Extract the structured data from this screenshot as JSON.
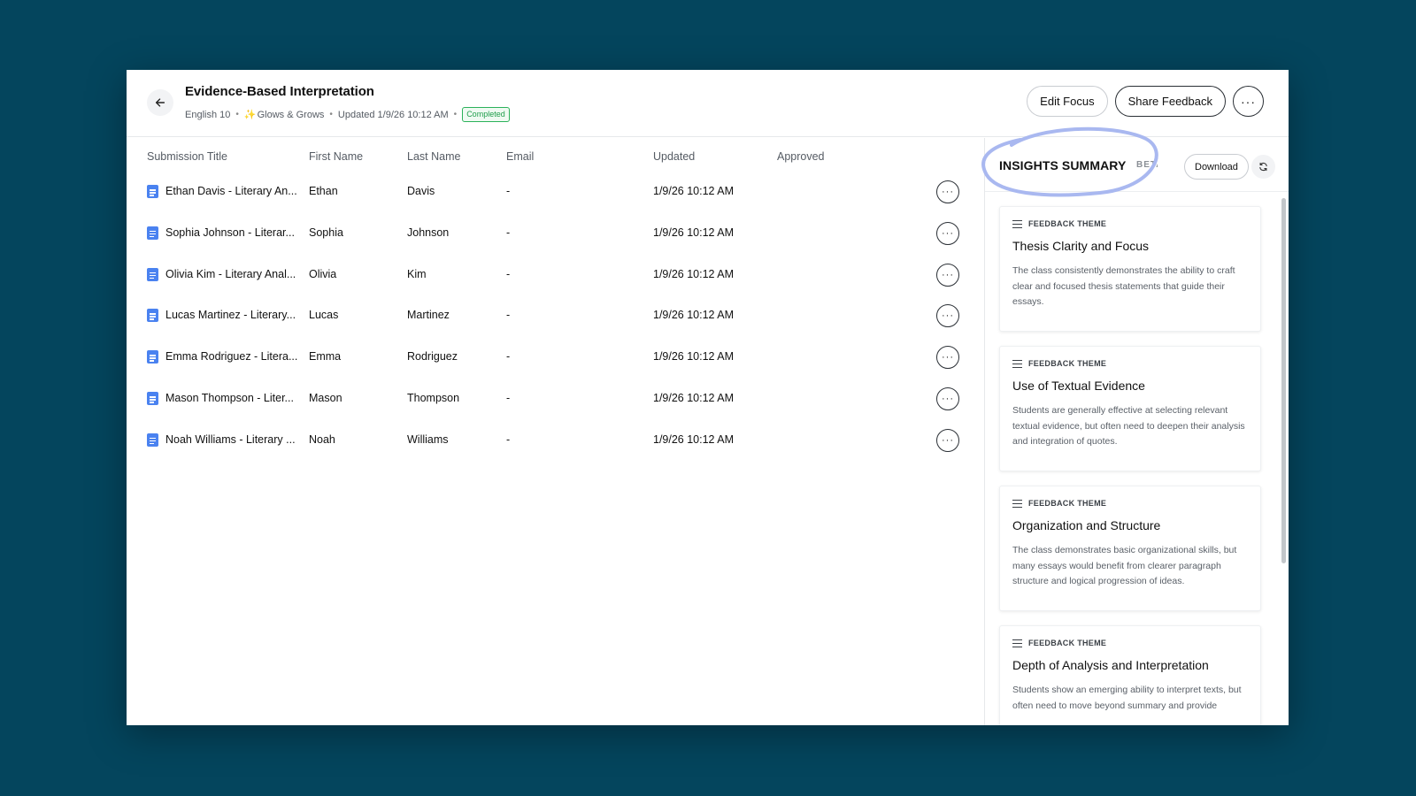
{
  "header": {
    "title": "Evidence-Based Interpretation",
    "course": "English 10",
    "mode": "Glows & Grows",
    "updated": "Updated 1/9/26 10:12 AM",
    "status": "Completed",
    "edit_focus": "Edit Focus",
    "share_feedback": "Share Feedback",
    "more": "···"
  },
  "table": {
    "columns": [
      "Submission Title",
      "First Name",
      "Last Name",
      "Email",
      "Updated",
      "Approved"
    ],
    "rows": [
      {
        "title": "Ethan Davis - Literary An...",
        "first": "Ethan",
        "last": "Davis",
        "email": "-",
        "updated": "1/9/26 10:12 AM",
        "approved": ""
      },
      {
        "title": "Sophia Johnson - Literar...",
        "first": "Sophia",
        "last": "Johnson",
        "email": "-",
        "updated": "1/9/26 10:12 AM",
        "approved": ""
      },
      {
        "title": "Olivia Kim - Literary Anal...",
        "first": "Olivia",
        "last": "Kim",
        "email": "-",
        "updated": "1/9/26 10:12 AM",
        "approved": ""
      },
      {
        "title": "Lucas Martinez - Literary...",
        "first": "Lucas",
        "last": "Martinez",
        "email": "-",
        "updated": "1/9/26 10:12 AM",
        "approved": ""
      },
      {
        "title": "Emma Rodriguez - Litera...",
        "first": "Emma",
        "last": "Rodriguez",
        "email": "-",
        "updated": "1/9/26 10:12 AM",
        "approved": ""
      },
      {
        "title": "Mason Thompson - Liter...",
        "first": "Mason",
        "last": "Thompson",
        "email": "-",
        "updated": "1/9/26 10:12 AM",
        "approved": ""
      },
      {
        "title": "Noah Williams - Literary ...",
        "first": "Noah",
        "last": "Williams",
        "email": "-",
        "updated": "1/9/26 10:12 AM",
        "approved": ""
      }
    ],
    "row_more": "···"
  },
  "insights": {
    "title": "INSIGHTS SUMMARY",
    "beta": "BETA",
    "download": "Download",
    "highlight_color": "#a9b8f0",
    "cards": [
      {
        "kicker": "FEEDBACK THEME",
        "title": "Thesis Clarity and Focus",
        "body": "The class consistently demonstrates the ability to craft clear and focused thesis statements that guide their essays."
      },
      {
        "kicker": "FEEDBACK THEME",
        "title": "Use of Textual Evidence",
        "body": "Students are generally effective at selecting relevant textual evidence, but often need to deepen their analysis and integration of quotes."
      },
      {
        "kicker": "FEEDBACK THEME",
        "title": "Organization and Structure",
        "body": "The class demonstrates basic organizational skills, but many essays would benefit from clearer paragraph structure and logical progression of ideas."
      },
      {
        "kicker": "FEEDBACK THEME",
        "title": "Depth of Analysis and Interpretation",
        "body": "Students show an emerging ability to interpret texts, but often need to move beyond summary and provide"
      }
    ]
  }
}
